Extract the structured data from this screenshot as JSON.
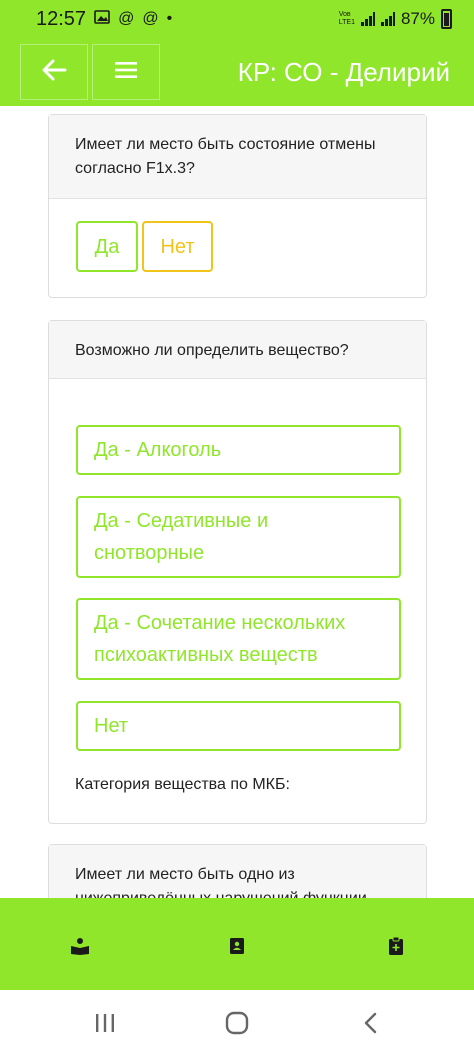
{
  "status_bar": {
    "time": "12:57",
    "icons": [
      "image-icon",
      "at-icon",
      "at-icon",
      "dot-icon"
    ],
    "network_top": "Voʙ",
    "network_bottom": "LTE1",
    "battery": "87%"
  },
  "app_bar": {
    "title": "КР: СО - Делирий",
    "back_icon": "arrow-left-icon",
    "menu_icon": "hamburger-menu-icon"
  },
  "cards": {
    "withdrawal": {
      "question": "Имеет ли место быть состояние отмены согласно F1x.3?",
      "yes_label": "Да",
      "no_label": "Нет"
    },
    "substance": {
      "question": "Возможно ли определить вещество?",
      "options": [
        "Да - Алкоголь",
        "Да - Седативные и снотворные",
        "Да - Сочетание нескольких психоактивных веществ",
        "Нет"
      ],
      "category_label": "Категория вещества по МКБ:"
    },
    "disorder": {
      "question": "Имеет ли место быть одно из нижеприведённых нарушений функции"
    }
  },
  "bottom_nav": {
    "items": [
      "reader-icon",
      "book-icon",
      "clipboard-icon"
    ]
  },
  "system_nav": {
    "items": [
      "recents-icon",
      "home-icon",
      "back-icon"
    ]
  },
  "colors": {
    "accent": "#8fe62b",
    "warning": "#f0c419",
    "card_header_bg": "#f6f6f6"
  }
}
